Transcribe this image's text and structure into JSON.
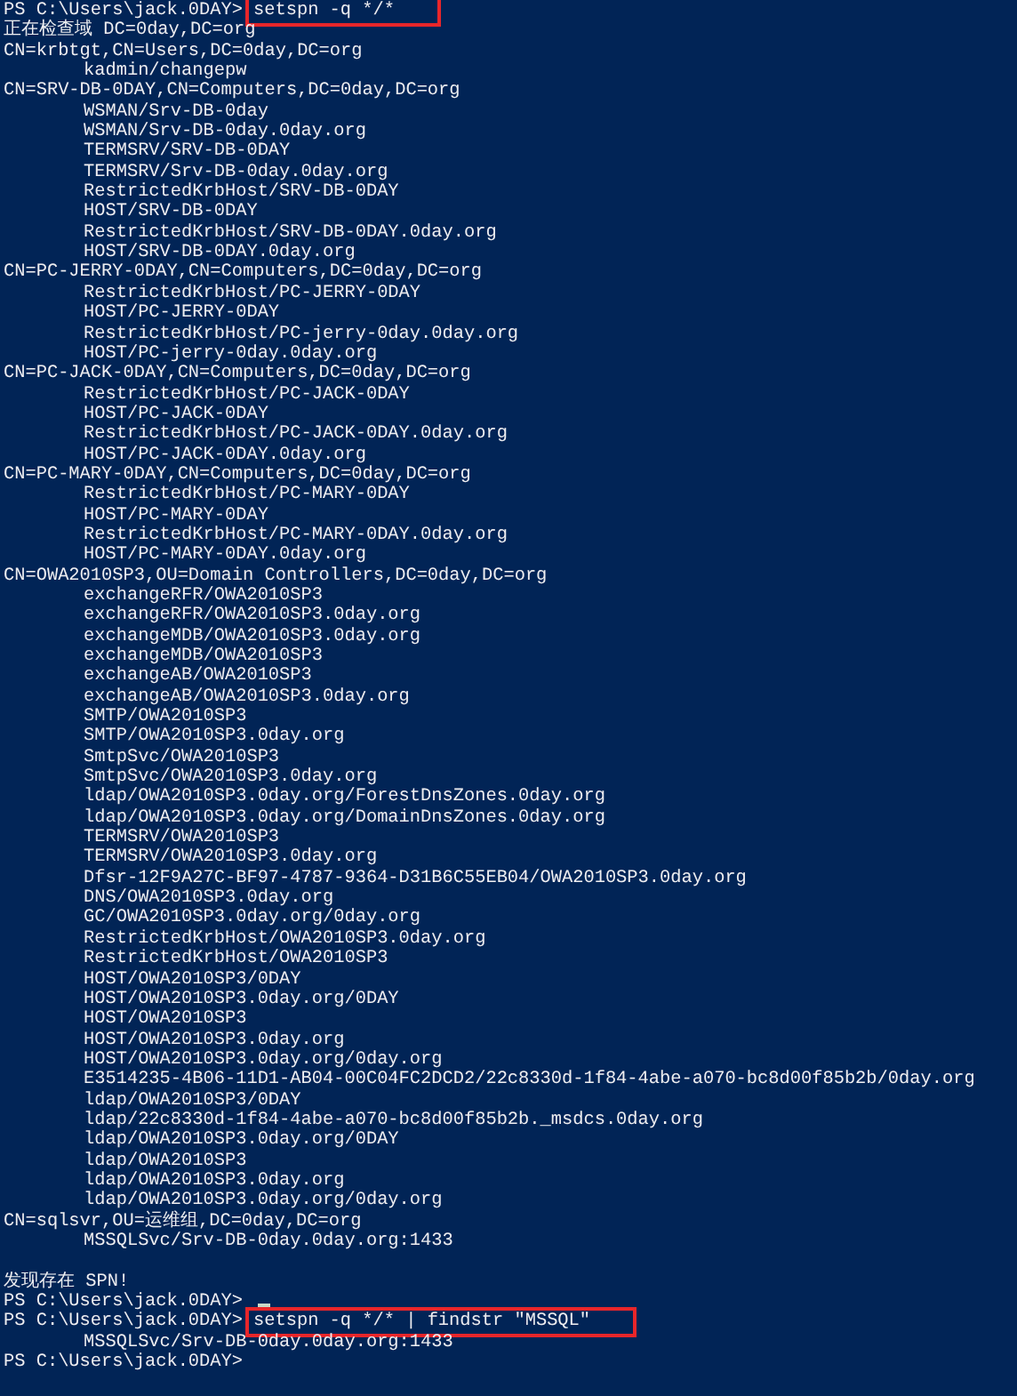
{
  "lines": [
    {
      "kind": "prompt",
      "prompt": "PS C:\\Users\\jack.0DAY>",
      "command": "setspn -q */*",
      "highlighted": true,
      "cursor": false
    },
    {
      "kind": "output",
      "text": "正在检查域 DC=0day,DC=org"
    },
    {
      "kind": "output",
      "text": "CN=krbtgt,CN=Users,DC=0day,DC=org"
    },
    {
      "kind": "spn",
      "text": "kadmin/changepw"
    },
    {
      "kind": "output",
      "text": "CN=SRV-DB-0DAY,CN=Computers,DC=0day,DC=org"
    },
    {
      "kind": "spn",
      "text": "WSMAN/Srv-DB-0day"
    },
    {
      "kind": "spn",
      "text": "WSMAN/Srv-DB-0day.0day.org"
    },
    {
      "kind": "spn",
      "text": "TERMSRV/SRV-DB-0DAY"
    },
    {
      "kind": "spn",
      "text": "TERMSRV/Srv-DB-0day.0day.org"
    },
    {
      "kind": "spn",
      "text": "RestrictedKrbHost/SRV-DB-0DAY"
    },
    {
      "kind": "spn",
      "text": "HOST/SRV-DB-0DAY"
    },
    {
      "kind": "spn",
      "text": "RestrictedKrbHost/SRV-DB-0DAY.0day.org"
    },
    {
      "kind": "spn",
      "text": "HOST/SRV-DB-0DAY.0day.org"
    },
    {
      "kind": "output",
      "text": "CN=PC-JERRY-0DAY,CN=Computers,DC=0day,DC=org"
    },
    {
      "kind": "spn",
      "text": "RestrictedKrbHost/PC-JERRY-0DAY"
    },
    {
      "kind": "spn",
      "text": "HOST/PC-JERRY-0DAY"
    },
    {
      "kind": "spn",
      "text": "RestrictedKrbHost/PC-jerry-0day.0day.org"
    },
    {
      "kind": "spn",
      "text": "HOST/PC-jerry-0day.0day.org"
    },
    {
      "kind": "output",
      "text": "CN=PC-JACK-0DAY,CN=Computers,DC=0day,DC=org"
    },
    {
      "kind": "spn",
      "text": "RestrictedKrbHost/PC-JACK-0DAY"
    },
    {
      "kind": "spn",
      "text": "HOST/PC-JACK-0DAY"
    },
    {
      "kind": "spn",
      "text": "RestrictedKrbHost/PC-JACK-0DAY.0day.org"
    },
    {
      "kind": "spn",
      "text": "HOST/PC-JACK-0DAY.0day.org"
    },
    {
      "kind": "output",
      "text": "CN=PC-MARY-0DAY,CN=Computers,DC=0day,DC=org"
    },
    {
      "kind": "spn",
      "text": "RestrictedKrbHost/PC-MARY-0DAY"
    },
    {
      "kind": "spn",
      "text": "HOST/PC-MARY-0DAY"
    },
    {
      "kind": "spn",
      "text": "RestrictedKrbHost/PC-MARY-0DAY.0day.org"
    },
    {
      "kind": "spn",
      "text": "HOST/PC-MARY-0DAY.0day.org"
    },
    {
      "kind": "output",
      "text": "CN=OWA2010SP3,OU=Domain Controllers,DC=0day,DC=org"
    },
    {
      "kind": "spn",
      "text": "exchangeRFR/OWA2010SP3"
    },
    {
      "kind": "spn",
      "text": "exchangeRFR/OWA2010SP3.0day.org"
    },
    {
      "kind": "spn",
      "text": "exchangeMDB/OWA2010SP3.0day.org"
    },
    {
      "kind": "spn",
      "text": "exchangeMDB/OWA2010SP3"
    },
    {
      "kind": "spn",
      "text": "exchangeAB/OWA2010SP3"
    },
    {
      "kind": "spn",
      "text": "exchangeAB/OWA2010SP3.0day.org"
    },
    {
      "kind": "spn",
      "text": "SMTP/OWA2010SP3"
    },
    {
      "kind": "spn",
      "text": "SMTP/OWA2010SP3.0day.org"
    },
    {
      "kind": "spn",
      "text": "SmtpSvc/OWA2010SP3"
    },
    {
      "kind": "spn",
      "text": "SmtpSvc/OWA2010SP3.0day.org"
    },
    {
      "kind": "spn",
      "text": "ldap/OWA2010SP3.0day.org/ForestDnsZones.0day.org"
    },
    {
      "kind": "spn",
      "text": "ldap/OWA2010SP3.0day.org/DomainDnsZones.0day.org"
    },
    {
      "kind": "spn",
      "text": "TERMSRV/OWA2010SP3"
    },
    {
      "kind": "spn",
      "text": "TERMSRV/OWA2010SP3.0day.org"
    },
    {
      "kind": "spn",
      "text": "Dfsr-12F9A27C-BF97-4787-9364-D31B6C55EB04/OWA2010SP3.0day.org"
    },
    {
      "kind": "spn",
      "text": "DNS/OWA2010SP3.0day.org"
    },
    {
      "kind": "spn",
      "text": "GC/OWA2010SP3.0day.org/0day.org"
    },
    {
      "kind": "spn",
      "text": "RestrictedKrbHost/OWA2010SP3.0day.org"
    },
    {
      "kind": "spn",
      "text": "RestrictedKrbHost/OWA2010SP3"
    },
    {
      "kind": "spn",
      "text": "HOST/OWA2010SP3/0DAY"
    },
    {
      "kind": "spn",
      "text": "HOST/OWA2010SP3.0day.org/0DAY"
    },
    {
      "kind": "spn",
      "text": "HOST/OWA2010SP3"
    },
    {
      "kind": "spn",
      "text": "HOST/OWA2010SP3.0day.org"
    },
    {
      "kind": "spn",
      "text": "HOST/OWA2010SP3.0day.org/0day.org"
    },
    {
      "kind": "spn",
      "text": "E3514235-4B06-11D1-AB04-00C04FC2DCD2/22c8330d-1f84-4abe-a070-bc8d00f85b2b/0day.org"
    },
    {
      "kind": "spn",
      "text": "ldap/OWA2010SP3/0DAY"
    },
    {
      "kind": "spn",
      "text": "ldap/22c8330d-1f84-4abe-a070-bc8d00f85b2b._msdcs.0day.org"
    },
    {
      "kind": "spn",
      "text": "ldap/OWA2010SP3.0day.org/0DAY"
    },
    {
      "kind": "spn",
      "text": "ldap/OWA2010SP3"
    },
    {
      "kind": "spn",
      "text": "ldap/OWA2010SP3.0day.org"
    },
    {
      "kind": "spn",
      "text": "ldap/OWA2010SP3.0day.org/0day.org"
    },
    {
      "kind": "output",
      "text": "CN=sqlsvr,OU=运维组,DC=0day,DC=org"
    },
    {
      "kind": "spn",
      "text": "MSSQLSvc/Srv-DB-0day.0day.org:1433"
    },
    {
      "kind": "blank"
    },
    {
      "kind": "output",
      "text": "发现存在 SPN!"
    },
    {
      "kind": "prompt",
      "prompt": "PS C:\\Users\\jack.0DAY>",
      "highlighted": false,
      "cursor": true
    },
    {
      "kind": "prompt",
      "prompt": "PS C:\\Users\\jack.0DAY>",
      "command": "setspn -q */* | findstr \"MSSQL\"",
      "highlighted": true,
      "cursor": false
    },
    {
      "kind": "spn",
      "text": "MSSQLSvc/Srv-DB-0day.0day.org:1433"
    },
    {
      "kind": "prompt",
      "prompt": "PS C:\\Users\\jack.0DAY>",
      "highlighted": false,
      "cursor": false
    }
  ]
}
